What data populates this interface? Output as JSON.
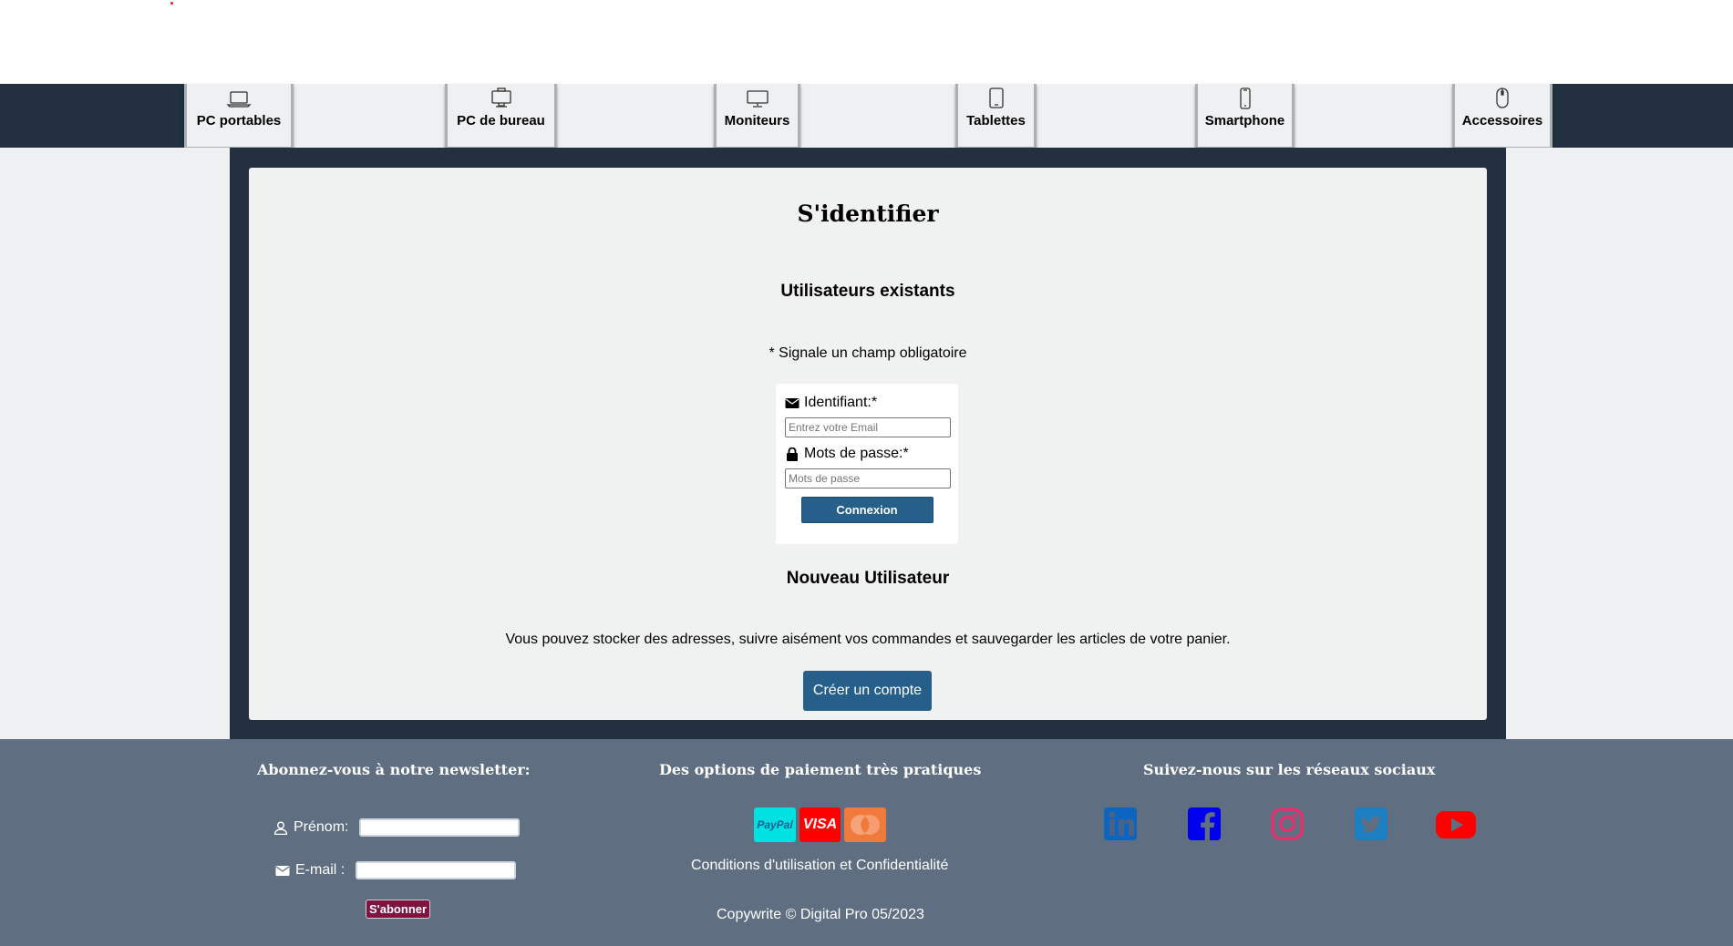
{
  "nav": {
    "items": [
      {
        "label": "PC portables",
        "icon": "laptop-icon"
      },
      {
        "label": "PC de bureau",
        "icon": "desktop-icon"
      },
      {
        "label": "Moniteurs",
        "icon": "monitor-icon"
      },
      {
        "label": "Tablettes",
        "icon": "tablet-icon"
      },
      {
        "label": "Smartphone",
        "icon": "smartphone-icon"
      },
      {
        "label": "Accessoires",
        "icon": "mouse-icon"
      }
    ]
  },
  "login": {
    "title": "S'identifier",
    "existing_heading": "Utilisateurs existants",
    "required_note": "* Signale un champ obligatoire",
    "id_label": "Identifiant:*",
    "id_placeholder": "Entrez votre Email",
    "pw_label": "Mots de passe:*",
    "pw_placeholder": "Mots de passe",
    "submit_label": "Connexion",
    "new_heading": "Nouveau Utilisateur",
    "new_text": "Vous pouvez stocker des adresses, suivre aisément vos commandes et sauvegarder les articles de votre panier.",
    "create_label": "Créer un compte"
  },
  "footer": {
    "newsletter_heading": "Abonnez-vous à notre newsletter:",
    "firstname_label": "Prénom:",
    "email_label": "E-mail :",
    "subscribe_label": "S'abonner",
    "payment_heading": "Des options de paiement très pratiques",
    "payment_methods": [
      "PayPal",
      "VISA",
      "Mastercard"
    ],
    "terms_link": "Conditions d'utilisation et Confidentialité",
    "copyright": "Copywrite © Digital Pro 05/2023",
    "social_heading": "Suivez-nous sur les réseaux sociaux",
    "social_icons": [
      "linkedin-icon",
      "facebook-icon",
      "instagram-icon",
      "twitter-icon",
      "youtube-icon"
    ]
  },
  "colors": {
    "navbar": "#22303f",
    "panel": "#f0f1f1",
    "button_blue": "#26608a",
    "footer": "#5f6e80",
    "subscribe": "#7d1540",
    "paypal": "#00e1e1",
    "visa": "#ff0000",
    "mastercard": "#f07a3c",
    "linkedin": "#0a66c2",
    "facebook": "#0000ee",
    "instagram": "#e1306c",
    "twitter": "#1d7fc2",
    "youtube": "#ff0000"
  }
}
